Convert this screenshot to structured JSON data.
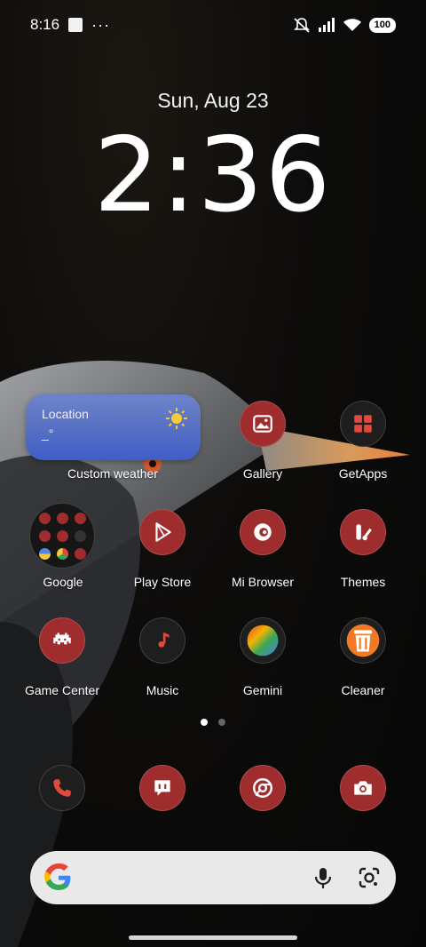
{
  "status_bar": {
    "time": "8:16",
    "dots": "···",
    "battery": "100",
    "icons": [
      "silent-icon",
      "signal-icon",
      "wifi-icon",
      "battery-icon"
    ]
  },
  "lock": {
    "date": "Sun, Aug 23",
    "time": "2:36"
  },
  "widget": {
    "location": "Location",
    "temperature": "_°",
    "label": "Custom weather",
    "icon": "sun-icon"
  },
  "apps": [
    {
      "label": "Gallery",
      "icon": "image-icon"
    },
    {
      "label": "GetApps",
      "icon": "grid-icon"
    },
    {
      "label": "Google",
      "icon": "folder-icon"
    },
    {
      "label": "Play Store",
      "icon": "play-icon"
    },
    {
      "label": "Mi Browser",
      "icon": "browser-icon"
    },
    {
      "label": "Themes",
      "icon": "brush-icon"
    },
    {
      "label": "Game Center",
      "icon": "invader-icon"
    },
    {
      "label": "Music",
      "icon": "music-note-icon"
    },
    {
      "label": "Gemini",
      "icon": "gemini-icon"
    },
    {
      "label": "Cleaner",
      "icon": "trash-icon"
    }
  ],
  "dock": [
    {
      "name": "Phone",
      "icon": "phone-icon"
    },
    {
      "name": "Messages",
      "icon": "message-icon"
    },
    {
      "name": "Chrome",
      "icon": "chrome-icon"
    },
    {
      "name": "Camera",
      "icon": "camera-icon"
    }
  ],
  "pager": {
    "pages": 2,
    "current": 1
  },
  "search": {
    "icons": [
      "google-logo",
      "mic-icon",
      "lens-icon"
    ]
  },
  "colors": {
    "accent": "#a02d2d",
    "weather_top": "#6e84c9",
    "weather_bottom": "#3f5fc7"
  }
}
